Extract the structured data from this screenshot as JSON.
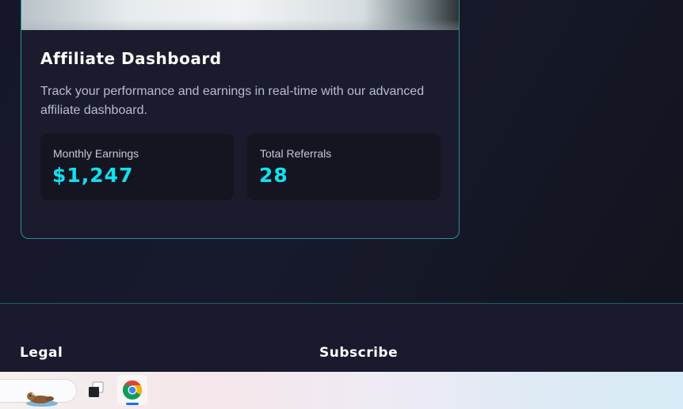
{
  "card": {
    "title": "Affiliate Dashboard",
    "description": "Track your performance and earnings in real-time with our advanced affiliate dashboard.",
    "stats": [
      {
        "label": "Monthly Earnings",
        "value": "$1,247"
      },
      {
        "label": "Total Referrals",
        "value": "28"
      }
    ]
  },
  "footer": {
    "legal_heading": "Legal",
    "subscribe_heading": "Subscribe"
  },
  "taskbar": {
    "icons": [
      "search-widget-otter-icon",
      "task-view-icon",
      "chrome-icon"
    ]
  },
  "colors": {
    "accent": "#12e0f0",
    "card_border": "#2c8f99",
    "background": "#13141f",
    "card_bg": "#1b1b2e"
  }
}
